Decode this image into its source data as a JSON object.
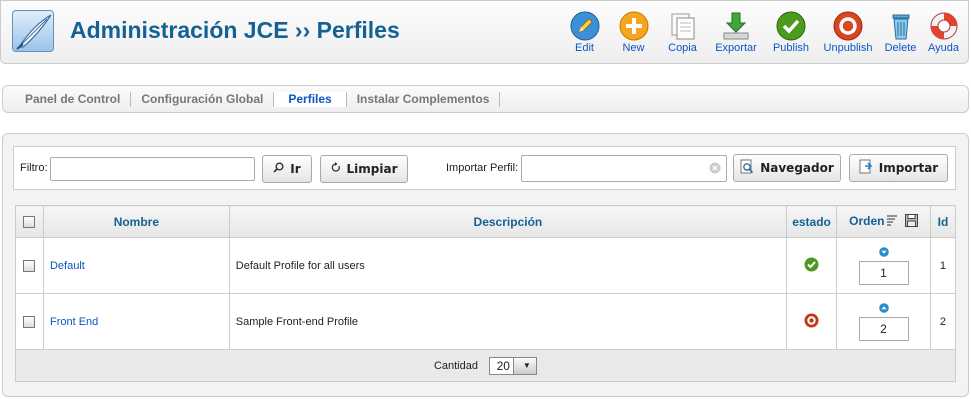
{
  "header": {
    "title": "Administración JCE ›› Perfiles"
  },
  "toolbar": {
    "edit": "Edit",
    "new": "New",
    "copy": "Copia",
    "export": "Exportar",
    "publish": "Publish",
    "unpublish": "Unpublish",
    "delete": "Delete",
    "help": "Ayuda"
  },
  "tabs": [
    "Panel de Control",
    "Configuración Global",
    "Perfiles",
    "Instalar Complementos"
  ],
  "active_tab": "Perfiles",
  "filter": {
    "label": "Filtro:",
    "value": "",
    "go_button": "Ir",
    "reset_button": "Limpiar",
    "import_label": "Importar Perfil:",
    "import_value": "",
    "browse_button": "Navegador",
    "import_button": "Importar"
  },
  "table": {
    "columns": {
      "name": "Nombre",
      "description": "Descripción",
      "state": "estado",
      "order": "Orden",
      "id": "Id"
    },
    "rows": [
      {
        "name": "Default",
        "description": "Default Profile for all users",
        "state": "published",
        "order": "1",
        "id": "1"
      },
      {
        "name": "Front End",
        "description": "Sample Front-end Profile",
        "state": "unpublished",
        "order": "2",
        "id": "2"
      }
    ],
    "footer": {
      "limit_label": "Cantidad",
      "limit_value": "20"
    }
  },
  "colors": {
    "title": "#146295",
    "link": "#0b55c4",
    "published": "#4c9a1f",
    "unpublished": "#c0391b",
    "order_arrow": "#2c8bd1"
  }
}
